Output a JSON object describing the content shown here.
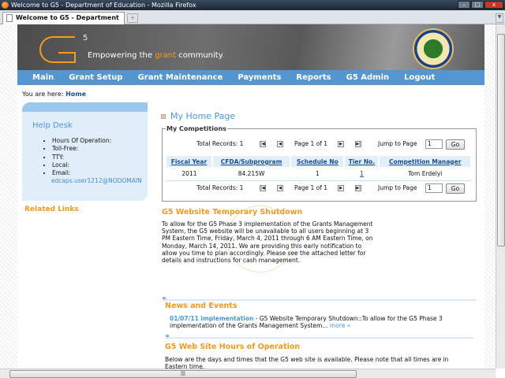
{
  "browser": {
    "window_title": "Welcome to G5 - Department of Education - Mozilla Firefox",
    "tab_title": "Welcome to G5 - Department of Edu...",
    "new_tab": "+"
  },
  "banner": {
    "logo_superscript": "5",
    "tagline_pre": "Empowering the ",
    "tagline_accent": "grant",
    "tagline_post": " community",
    "tagline_dot": ".",
    "accent_color": "#f39a1f"
  },
  "nav": {
    "items": [
      "Main",
      "Grant Setup",
      "Grant Maintenance",
      "Payments",
      "Reports",
      "G5 Admin",
      "Logout"
    ],
    "color": "#5595d0"
  },
  "breadcrumb": {
    "label": "You are here:",
    "current": "Home"
  },
  "helpdesk": {
    "title": "Help Desk",
    "items": [
      "Hours Of Operation:",
      "Toll-Free:",
      "TTY:",
      "Local:",
      "Email:"
    ],
    "email": "edcaps.user1212@NODOMAIN"
  },
  "related_links": "Related Links",
  "main": {
    "title": "My Home Page",
    "competitions": {
      "legend": "My Competitions",
      "total_records": "Total Records: 1",
      "page_info": "Page 1 of 1",
      "jump_label": "Jump to Page",
      "jump_value": "1",
      "go_label": "Go",
      "columns": [
        "Fiscal Year",
        "CFDA/Subprogram",
        "Schedule No",
        "Tier No.",
        "Competition Manager"
      ],
      "rows": [
        [
          "2011",
          "84.215W",
          "1",
          "1",
          "Tom Erdelyi"
        ]
      ]
    },
    "shutdown": {
      "title": "G5 Website Temporary Shutdown",
      "body": "To allow for the G5 Phase 3 implementation of the Grants Management System, the G5 website will be unavailable to all users beginning at 3 PM Eastern Time, Friday, March 4, 2011 through 6 AM Eastern Time, on Monday, March 14, 2011. We are providing this early notification to allow you time to plan accordingly. Please see the attached letter for details and instructions for cash management."
    },
    "news": {
      "title": "News and Events",
      "link": "01/07/11 implementation",
      "text": " - G5 Website Temporary Shutdown::To allow for the G5 Phase 3 implementation of the Grants Management System... ",
      "more": "more »"
    },
    "hours": {
      "title": "G5 Web Site Hours of Operation",
      "body": "Below are the days and times that the G5 web site is available. Please note that all times are in Eastern time."
    }
  }
}
